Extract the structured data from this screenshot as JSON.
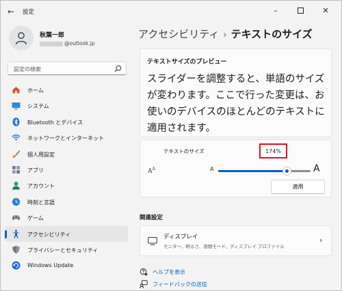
{
  "window": {
    "app_title": "設定",
    "back_icon": "back-arrow-icon",
    "controls": [
      "minimize-icon",
      "maximize-icon",
      "close-icon"
    ]
  },
  "account": {
    "name": "秋葉一郎",
    "email_suffix": "@outlook.jp",
    "avatar_icon": "person-icon"
  },
  "search": {
    "placeholder": "設定の検索"
  },
  "sidebar": {
    "items": [
      {
        "label": "ホーム",
        "icon": "home-icon",
        "color": "#c85a3a"
      },
      {
        "label": "システム",
        "icon": "system-icon",
        "color": "#2b8bd8"
      },
      {
        "label": "Bluetooth とデバイス",
        "icon": "bluetooth-icon",
        "color": "#1a6ed8"
      },
      {
        "label": "ネットワークとインターネット",
        "icon": "wifi-icon",
        "color": "#2b6fd3"
      },
      {
        "label": "個人用設定",
        "icon": "brush-icon",
        "color": "#e07a28"
      },
      {
        "label": "アプリ",
        "icon": "apps-icon",
        "color": "#6b7a93"
      },
      {
        "label": "アカウント",
        "icon": "account-icon",
        "color": "#22a36e"
      },
      {
        "label": "時刻と言語",
        "icon": "time-language-icon",
        "color": "#2b7fd0"
      },
      {
        "label": "ゲーム",
        "icon": "game-icon",
        "color": "#6d6d6d"
      },
      {
        "label": "アクセシビリティ",
        "icon": "accessibility-icon",
        "color": "#1a5fc9"
      },
      {
        "label": "プライバシーとセキュリティ",
        "icon": "shield-icon",
        "color": "#6f7580"
      },
      {
        "label": "Windows Update",
        "icon": "update-icon",
        "color": "#1a6ed8"
      }
    ],
    "active_index": 9
  },
  "breadcrumb": {
    "parent": "アクセシビリティ",
    "separator": "›",
    "current": "テキストのサイズ"
  },
  "preview": {
    "title": "テキストサイズのプレビュー",
    "text": "スライダーを調整すると、単語のサイズが変わります。ここで行った変更は、お使いのデバイスのほとんどのテキストに適用されます。"
  },
  "text_size": {
    "label": "テキストのサイズ",
    "value": "174%",
    "slider_fraction": 0.74,
    "slider_small_label": "A",
    "slider_big_label": "A",
    "icon": "text-size-icon",
    "apply_label": "適用",
    "highlight_color": "#e0101e"
  },
  "related": {
    "header": "関連設定",
    "display": {
      "title": "ディスプレイ",
      "description": "モニター、明るさ、夜間モード、ディスプレイ プロファイル",
      "icon": "display-icon"
    }
  },
  "links": {
    "help": "ヘルプを表示",
    "feedback": "フィードバックの送信"
  },
  "colors": {
    "accent": "#005fb8",
    "background": "#f3f3f3"
  }
}
